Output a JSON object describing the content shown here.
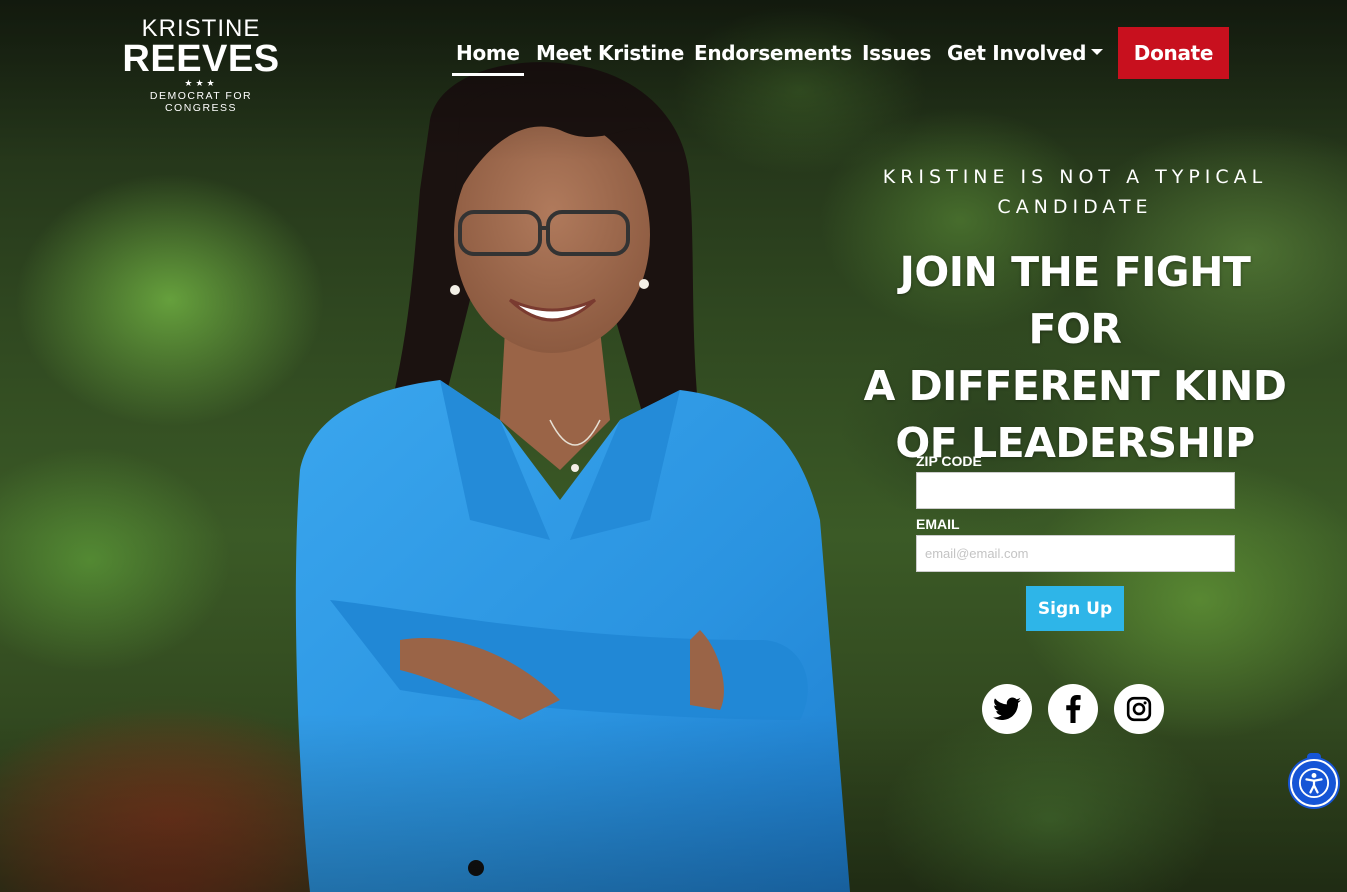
{
  "brand": {
    "first_name": "KRISTINE",
    "last_name": "REEVES",
    "stars": "★★★",
    "tagline": "DEMOCRAT FOR CONGRESS"
  },
  "nav": {
    "items": [
      {
        "label": "Home",
        "active": true
      },
      {
        "label": "Meet Kristine",
        "active": false
      },
      {
        "label": "Endorsements",
        "active": false
      },
      {
        "label": "Issues",
        "active": false
      },
      {
        "label": "Get Involved",
        "active": false,
        "has_dropdown": true
      }
    ],
    "donate_label": "Donate"
  },
  "hero": {
    "eyebrow_line1": "KRISTINE IS NOT A TYPICAL",
    "eyebrow_line2": "CANDIDATE",
    "headline_line1": "JOIN THE FIGHT FOR",
    "headline_line2": "A DIFFERENT KIND",
    "headline_line3": "OF LEADERSHIP"
  },
  "form": {
    "zip_label": "ZIP CODE",
    "zip_value": "",
    "email_label": "EMAIL",
    "email_placeholder": "email@email.com",
    "email_value": "",
    "submit_label": "Sign Up"
  },
  "social": [
    "twitter-icon",
    "facebook-icon",
    "instagram-icon"
  ],
  "accessibility": {
    "icon": "accessibility-icon"
  },
  "colors": {
    "donate": "#c8101e",
    "signup": "#2eb5e8",
    "accessibility": "#1655d6",
    "blazer": "#2a93e0"
  }
}
